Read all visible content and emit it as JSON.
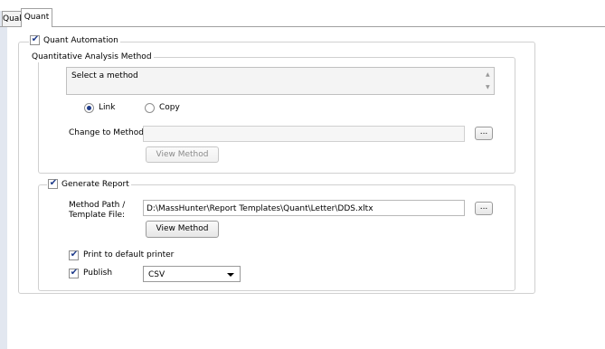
{
  "tabs": [
    {
      "label": "Qual"
    },
    {
      "label": "Quant"
    }
  ],
  "quant_automation": {
    "label": "Quant Automation",
    "checked": true
  },
  "method_group": {
    "legend": "Quantitative Analysis Method",
    "list_text": "Select a method",
    "radio_link": {
      "label": "Link",
      "selected": true
    },
    "radio_copy": {
      "label": "Copy",
      "selected": false
    },
    "change_label": "Change to Method:",
    "change_value": "",
    "browse_label": "...",
    "view_method_label": "View Method"
  },
  "report_group": {
    "legend": "Generate Report",
    "checked": true,
    "path_label_line1": "Method Path /",
    "path_label_line2": "Template File:",
    "path_value": "D:\\MassHunter\\Report Templates\\Quant\\Letter\\DDS.xltx",
    "browse_label": "...",
    "view_method_label": "View Method",
    "print_label": "Print to default printer",
    "print_checked": true,
    "publish_label": "Publish",
    "publish_checked": true,
    "publish_format": "CSV"
  }
}
